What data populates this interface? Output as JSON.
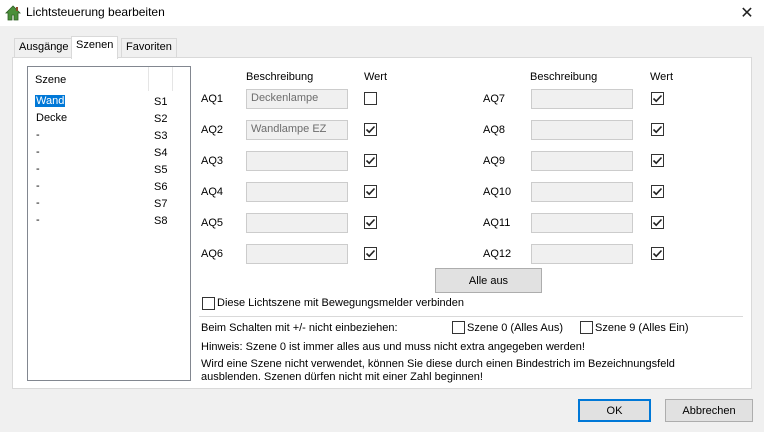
{
  "window": {
    "title": "Lichtsteuerung bearbeiten"
  },
  "tabs": [
    {
      "label": "Ausgänge"
    },
    {
      "label": "Szenen"
    },
    {
      "label": "Favoriten"
    }
  ],
  "scenes": {
    "header": "Szene",
    "items": [
      {
        "name": "Wand",
        "code": "S1"
      },
      {
        "name": "Decke",
        "code": "S2"
      },
      {
        "name": "-",
        "code": "S3"
      },
      {
        "name": "-",
        "code": "S4"
      },
      {
        "name": "-",
        "code": "S5"
      },
      {
        "name": "-",
        "code": "S6"
      },
      {
        "name": "-",
        "code": "S7"
      },
      {
        "name": "-",
        "code": "S8"
      }
    ]
  },
  "outputs": {
    "desc_header": "Beschreibung",
    "value_header": "Wert",
    "left": [
      {
        "label": "AQ1",
        "desc": "Deckenlampe",
        "checked": false
      },
      {
        "label": "AQ2",
        "desc": "Wandlampe EZ",
        "checked": true
      },
      {
        "label": "AQ3",
        "desc": "",
        "checked": true
      },
      {
        "label": "AQ4",
        "desc": "",
        "checked": true
      },
      {
        "label": "AQ5",
        "desc": "",
        "checked": true
      },
      {
        "label": "AQ6",
        "desc": "",
        "checked": true
      }
    ],
    "right": [
      {
        "label": "AQ7",
        "desc": "",
        "checked": true
      },
      {
        "label": "AQ8",
        "desc": "",
        "checked": true
      },
      {
        "label": "AQ9",
        "desc": "",
        "checked": true
      },
      {
        "label": "AQ10",
        "desc": "",
        "checked": true
      },
      {
        "label": "AQ11",
        "desc": "",
        "checked": true
      },
      {
        "label": "AQ12",
        "desc": "",
        "checked": true
      }
    ]
  },
  "all_off_button": "Alle aus",
  "motion_sensor_label": "Diese Lichtszene mit Bewegungsmelder verbinden",
  "exclude": {
    "label": "Beim Schalten mit +/- nicht einbeziehen:",
    "scene0": "Szene 0 (Alles Aus)",
    "scene9": "Szene 9 (Alles Ein)"
  },
  "hint1": "Hinweis: Szene 0 ist immer alles aus und muss nicht extra angegeben werden!",
  "hint2_line1": "Wird eine Szene nicht verwendet, können Sie diese durch einen Bindestrich im Bezeichnungsfeld",
  "hint2_line2": "ausblenden. Szenen dürfen nicht mit einer Zahl beginnen!",
  "ok_button": "OK",
  "cancel_button": "Abbrechen",
  "icons": {
    "app": "home-icon",
    "close": "close-icon",
    "check": "checkmark-icon"
  }
}
